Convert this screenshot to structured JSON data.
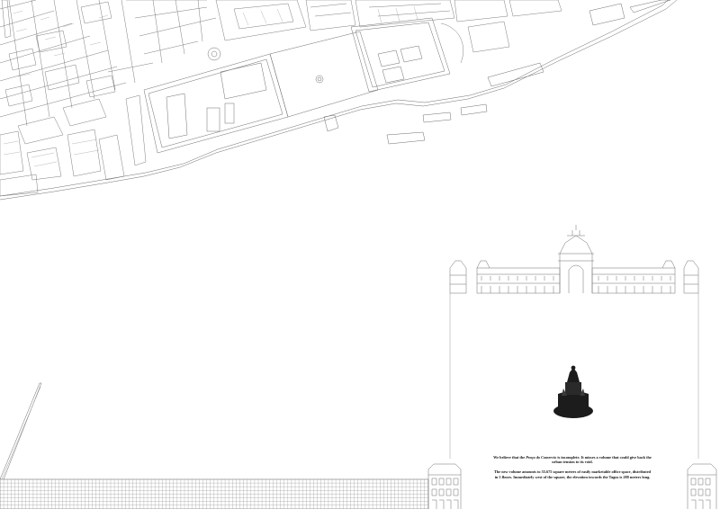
{
  "panel": {
    "colors": {
      "line": "#6e6e6e",
      "thin": "#9a9a9a",
      "statue": "#1c1c1c",
      "background": "#ffffff"
    },
    "caption": {
      "p1_before": "We believe that the ",
      "p1_place": "Praça do Comercio",
      "p1_after": " is incomplete. It misses a volume that could give back the urban tension to its void.",
      "p2": "The new volume amounts to 55.675 square meters of easily marketable office space, distributed in 5 floors. Immediately west of the square, the elevation towards the Tagus is 288 meters long."
    }
  }
}
